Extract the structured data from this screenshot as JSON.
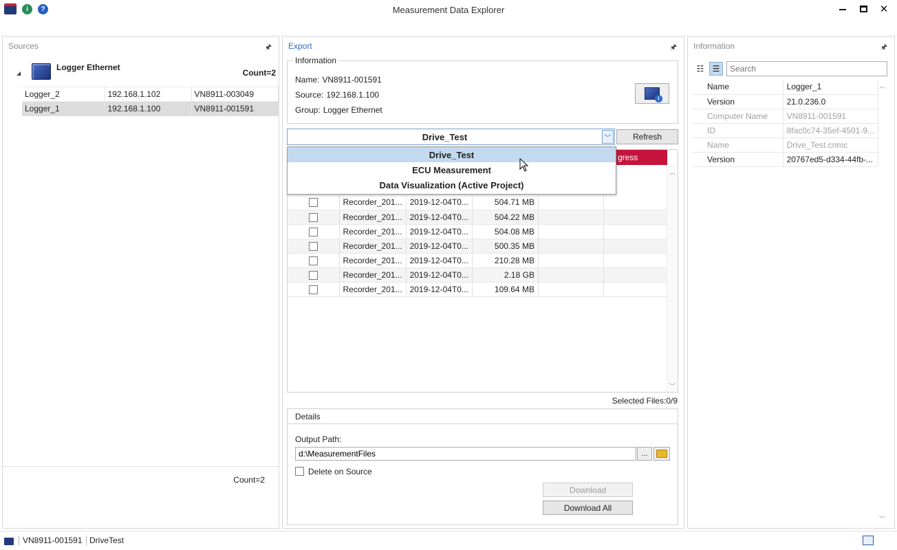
{
  "window": {
    "title": "Measurement Data Explorer"
  },
  "sources": {
    "header": "Sources",
    "group": {
      "name": "Logger Ethernet",
      "count": "Count=2"
    },
    "rows": [
      {
        "name": "Logger_2",
        "ip": "192.168.1.102",
        "id": "VN8911-003049"
      },
      {
        "name": "Logger_1",
        "ip": "192.168.1.100",
        "id": "VN8911-001591"
      }
    ],
    "footer_count": "Count=2"
  },
  "export": {
    "header": "Export",
    "info_title": "Information",
    "name_label": "Name:",
    "name_value": "VN8911-001591",
    "source_label": "Source:",
    "source_value": "192.168.1.100",
    "group_label": "Group:",
    "group_value": "Logger Ethernet",
    "combo_value": "Drive_Test",
    "refresh_label": "Refresh",
    "dropdown_options": [
      "Drive_Test",
      "ECU Measurement",
      "Data Visualization (Active Project)"
    ],
    "progress_header": "gress",
    "files": [
      {
        "name": "Recorder_201...",
        "date": "2019-12-04T0...",
        "size": "504.71 MB"
      },
      {
        "name": "Recorder_201...",
        "date": "2019-12-04T0...",
        "size": "504.22 MB"
      },
      {
        "name": "Recorder_201...",
        "date": "2019-12-04T0...",
        "size": "504.08 MB"
      },
      {
        "name": "Recorder_201...",
        "date": "2019-12-04T0...",
        "size": "500.35 MB"
      },
      {
        "name": "Recorder_201...",
        "date": "2019-12-04T0...",
        "size": "210.28 MB"
      },
      {
        "name": "Recorder_201...",
        "date": "2019-12-04T0...",
        "size": "2.18 GB"
      },
      {
        "name": "Recorder_201...",
        "date": "2019-12-04T0...",
        "size": "109.64 MB"
      }
    ],
    "selected_files": "Selected Files:0/9",
    "details": {
      "header": "Details",
      "output_label": "Output Path:",
      "output_value": "d:\\MeasurementFiles",
      "browse_label": "...",
      "delete_label": "Delete on Source",
      "download_label": "Download",
      "download_all_label": "Download All"
    }
  },
  "info": {
    "header": "Information",
    "search_placeholder": "Search",
    "props": [
      {
        "key": "Name",
        "value": "Logger_1",
        "dim": false
      },
      {
        "key": "Version",
        "value": "21.0.236.0",
        "dim": false
      },
      {
        "key": "Computer Name",
        "value": "VN8911-001591",
        "dim": true
      },
      {
        "key": "ID",
        "value": "8fac0c74-35ef-4501-9...",
        "dim": true
      },
      {
        "key": "Name",
        "value": "Drive_Test.cnmc",
        "dim": true
      },
      {
        "key": "Version",
        "value": "20767ed5-d334-44fb-...",
        "dim": false
      }
    ]
  },
  "status": {
    "device": "VN8911-001591",
    "project": "DriveTest"
  },
  "colors": {
    "progress_header": "#c4143c",
    "selection": "#c3d9ef"
  }
}
